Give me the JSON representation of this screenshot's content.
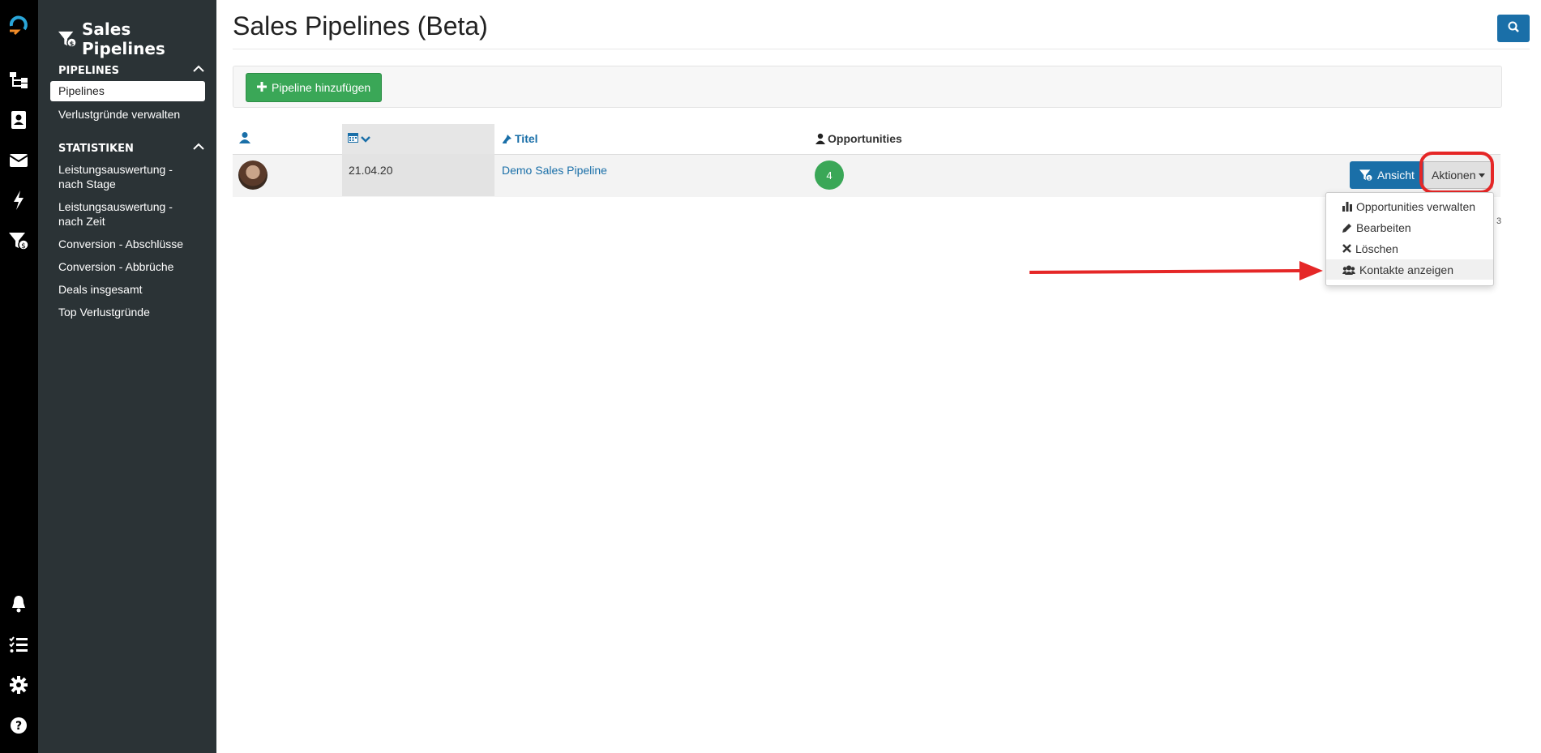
{
  "colors": {
    "accent": "#1a6fa8",
    "success": "#3aa757",
    "highlight": "#e52727",
    "sidebar": "#2b3336"
  },
  "icon_bar": [
    "logo-icon",
    "sitemap-icon",
    "contacts-icon",
    "mail-icon",
    "bolt-icon",
    "sales-funnel-icon",
    "bell-icon",
    "tasks-icon",
    "gear-icon",
    "help-icon"
  ],
  "sidebar": {
    "title": "Sales Pipelines",
    "sections": [
      {
        "label": "PIPELINES",
        "items": [
          {
            "label": "Pipelines",
            "active": true
          },
          {
            "label": "Verlustgründe verwalten",
            "active": false
          }
        ]
      },
      {
        "label": "STATISTIKEN",
        "items": [
          {
            "label": "Leistungsauswertung - nach Stage"
          },
          {
            "label": "Leistungsauswertung - nach Zeit"
          },
          {
            "label": "Conversion - Abschlüsse"
          },
          {
            "label": "Conversion - Abbrüche"
          },
          {
            "label": "Deals insgesamt"
          },
          {
            "label": "Top Verlustgründe"
          }
        ]
      }
    ]
  },
  "header": {
    "title": "Sales Pipelines (Beta)"
  },
  "toolbar": {
    "add_label": "Pipeline hinzufügen"
  },
  "table": {
    "columns": {
      "owner": "",
      "date": "",
      "title": "Titel",
      "opportunities": "Opportunities"
    },
    "rows": [
      {
        "date": "21.04.20",
        "title": "Demo Sales Pipeline",
        "opportunities": "4",
        "view_label": "Ansicht",
        "actions_label": "Aktionen"
      }
    ]
  },
  "dropdown": {
    "items": [
      {
        "label": "Opportunities verwalten",
        "icon": "bar-chart-icon"
      },
      {
        "label": "Bearbeiten",
        "icon": "pencil-icon"
      },
      {
        "label": "Löschen",
        "icon": "close-icon"
      },
      {
        "label": "Kontakte anzeigen",
        "icon": "users-icon",
        "highlighted": true
      }
    ]
  },
  "pagination": {
    "text": "3"
  }
}
